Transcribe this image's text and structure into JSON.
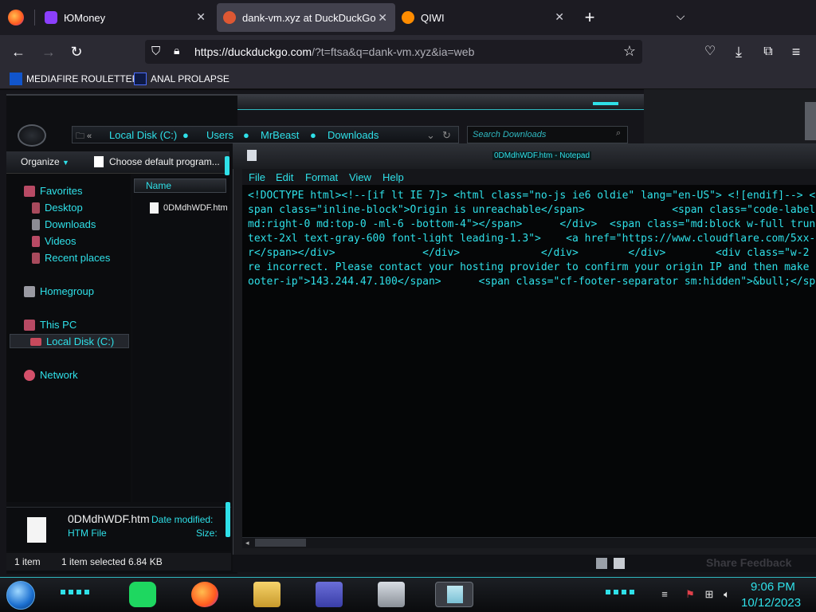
{
  "browser": {
    "tabs": [
      {
        "label": "ЮMoney",
        "active": false
      },
      {
        "label": "dank-vm.xyz at DuckDuckGo",
        "active": true
      },
      {
        "label": "QIWI",
        "active": false
      }
    ],
    "new_tab_icon": "plus-icon",
    "url_host": "https://duckduckgo.com",
    "url_path": "/?t=ftsa&q=dank-vm.xyz&ia=web",
    "bookmarks": [
      {
        "label": "MEDIAFIRE ROULETTER"
      },
      {
        "label": "ANAL PROLAPSE"
      }
    ]
  },
  "explorer": {
    "breadcrumb": [
      "Local Disk (C:)",
      "Users",
      "MrBeast",
      "Downloads"
    ],
    "search_placeholder": "Search Downloads",
    "toolbar": {
      "organize": "Organize",
      "choose_default": "Choose default program..."
    },
    "nav": {
      "favorites": "Favorites",
      "desktop": "Desktop",
      "downloads": "Downloads",
      "videos": "Videos",
      "recent": "Recent places",
      "homegroup": "Homegroup",
      "this_pc": "This PC",
      "local_disk": "Local Disk (C:)",
      "network": "Network"
    },
    "column_name": "Name",
    "file_name": "0DMdhWDF.htm",
    "details": {
      "name": "0DMdhWDF.htm",
      "date_label": "Date modified:",
      "type": "HTM File",
      "size_label": "Size:"
    },
    "status": {
      "items": "1 item",
      "selected": "1 item selected",
      "size": "6.84 KB"
    }
  },
  "notepad": {
    "title": "0DMdhWDF.htm - Notepad",
    "menu": [
      "File",
      "Edit",
      "Format",
      "View",
      "Help"
    ],
    "lines": [
      "<!DOCTYPE html><!--[if lt IE 7]> <html class=\"no-js ie6 oldie\" lang=\"en-US\"> <![endif]--> <!-",
      "span class=\"inline-block\">Origin is unreachable</span>              <span class=\"code-label\">",
      "md:right-0 md:top-0 -ml-6 -bottom-4\"></span>      </div>  <span class=\"md:block w-full trunc",
      "text-2xl text-gray-600 font-light leading-1.3\">    <a href=\"https://www.cloudflare.com/5xx-er",
      "r</span></div>              </div>             </div>        </div>        <div class=\"w-2",
      "re incorrect. Please contact your hosting provider to confirm your origin IP and then make su",
      "ooter-ip\">143.244.47.100</span>      <span class=\"cf-footer-separator sm:hidden\">&bull;</sp"
    ]
  },
  "background_text": "Share Feedback",
  "taskbar": {
    "time": "9:06 PM",
    "date": "10/12/2023"
  }
}
